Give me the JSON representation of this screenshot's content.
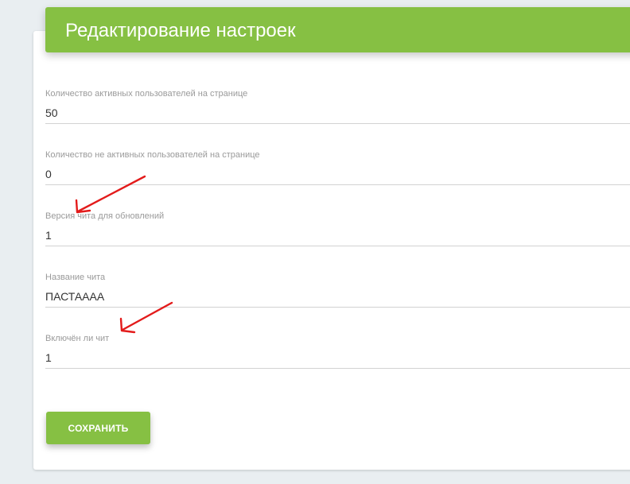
{
  "header": {
    "title": "Редактирование настроек"
  },
  "fields": [
    {
      "label": "Количество активных пользователей на странице",
      "value": "50"
    },
    {
      "label": "Количество не активных пользователей на странице",
      "value": "0"
    },
    {
      "label": "Версия чита для обновлений",
      "value": "1"
    },
    {
      "label": "Название чита",
      "value": "ПАСТАААА"
    },
    {
      "label": "Включён ли чит",
      "value": "1"
    }
  ],
  "actions": {
    "save_label": "СОХРАНИТЬ"
  },
  "colors": {
    "accent": "#86c043",
    "annotation_arrow": "#e31b1b",
    "background": "#e9eef1"
  }
}
